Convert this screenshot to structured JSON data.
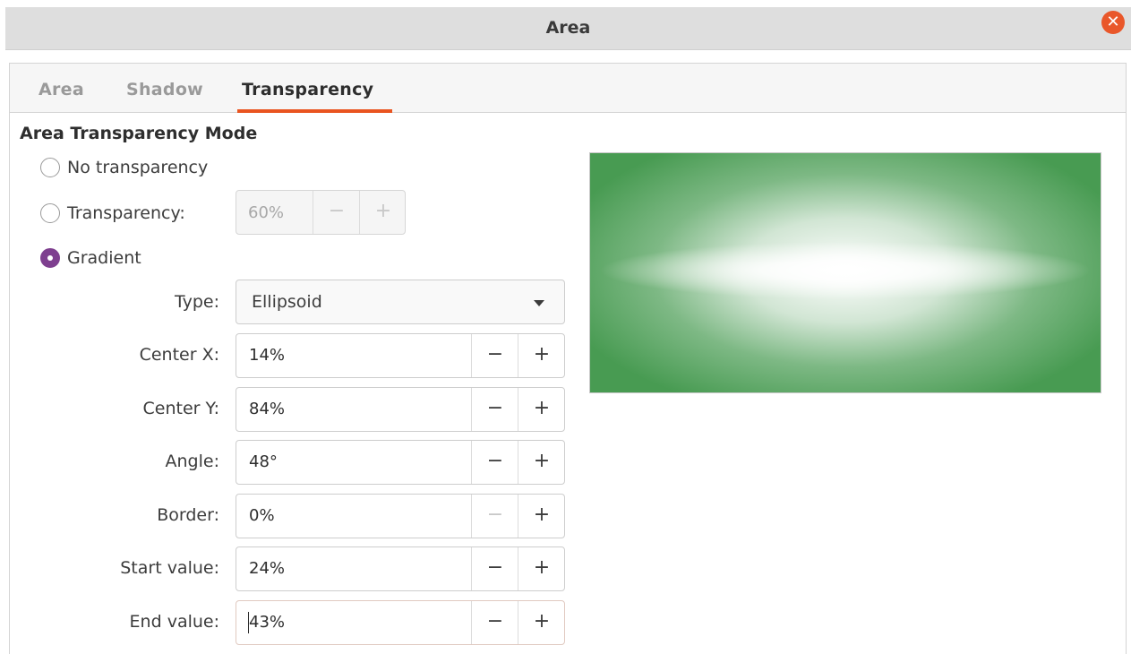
{
  "window": {
    "title": "Area",
    "close_glyph": "✕"
  },
  "tabs": [
    {
      "label": "Area",
      "active": false
    },
    {
      "label": "Shadow",
      "active": false
    },
    {
      "label": "Transparency",
      "active": true
    }
  ],
  "section": {
    "title": "Area Transparency Mode"
  },
  "modes": {
    "no_transparency": {
      "label": "No transparency",
      "checked": false
    },
    "transparency": {
      "label": "Transparency:",
      "checked": false,
      "value": "60%",
      "minus": "−",
      "plus": "+"
    },
    "gradient": {
      "label": "Gradient",
      "checked": true
    }
  },
  "gradient": {
    "type": {
      "label": "Type:",
      "value": "Ellipsoid"
    },
    "center_x": {
      "label": "Center X:",
      "value": "14%"
    },
    "center_y": {
      "label": "Center Y:",
      "value": "84%"
    },
    "angle": {
      "label": "Angle:",
      "value": "48°"
    },
    "border": {
      "label": "Border:",
      "value": "0%"
    },
    "start_value": {
      "label": "Start value:",
      "value": "24%"
    },
    "end_value": {
      "label": "End value:",
      "value": "43%"
    }
  },
  "spin_glyphs": {
    "minus": "−",
    "plus": "+"
  },
  "colors": {
    "accent": "#e95420",
    "radio_checked": "#7e3f8f",
    "preview_green": "#4a9a54"
  }
}
